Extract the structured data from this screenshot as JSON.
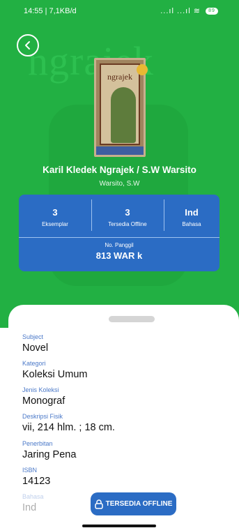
{
  "status_bar": {
    "time": "14:55 | 7,1KB/d",
    "signal": "...ıl ...ıl",
    "battery": "89"
  },
  "hero": {
    "background_text": "ngrajek",
    "cover_title": "ngrajek",
    "title": "Karil Kledek Ngrajek / S.W Warsito",
    "author": "Warsito, S.W"
  },
  "stats": [
    {
      "value": "3",
      "label": "Eksemplar"
    },
    {
      "value": "3",
      "label": "Tersedia Offline"
    },
    {
      "value": "Ind",
      "label": "Bahasa"
    }
  ],
  "call_number": {
    "label": "No. Panggil",
    "value": "813 WAR k"
  },
  "details": [
    {
      "label": "Subject",
      "value": "Novel"
    },
    {
      "label": "Kategori",
      "value": "Koleksi Umum"
    },
    {
      "label": "Jenis Koleksi",
      "value": "Monograf"
    },
    {
      "label": "Deskripsi Fisik",
      "value": "vii, 214 hlm. ; 18 cm."
    },
    {
      "label": "Penerbitan",
      "value": "Jaring Pena"
    },
    {
      "label": "ISBN",
      "value": "14123"
    },
    {
      "label": "Bahasa",
      "value": "Ind"
    }
  ],
  "offline_button": {
    "label": "TERSEDIA OFFLINE"
  },
  "colors": {
    "green": "#22b043",
    "blue": "#2b6cc4",
    "label_blue": "#4a78c8"
  }
}
